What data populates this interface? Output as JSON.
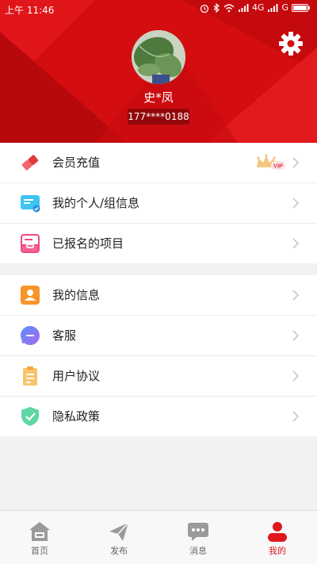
{
  "status": {
    "time": "上午 11:46",
    "network": "4G",
    "network2": "G"
  },
  "profile": {
    "name": "史*凤",
    "phone": "177****0188"
  },
  "menu_group1": [
    {
      "label": "会员充值",
      "icon": "eraser-icon",
      "badge": "VIP"
    },
    {
      "label": "我的个人/组信息",
      "icon": "id-card-icon"
    },
    {
      "label": "已报名的项目",
      "icon": "inbox-icon"
    }
  ],
  "menu_group2": [
    {
      "label": "我的信息",
      "icon": "user-icon"
    },
    {
      "label": "客服",
      "icon": "chat-icon"
    },
    {
      "label": "用户协议",
      "icon": "clipboard-icon"
    },
    {
      "label": "隐私政策",
      "icon": "shield-icon"
    }
  ],
  "tabs": [
    {
      "label": "首页",
      "icon": "home-icon",
      "active": false
    },
    {
      "label": "发布",
      "icon": "paper-plane-icon",
      "active": false
    },
    {
      "label": "消息",
      "icon": "message-icon",
      "active": false
    },
    {
      "label": "我的",
      "icon": "person-icon",
      "active": true
    }
  ],
  "colors": {
    "brand": "#d40d10",
    "tab_active": "#e0181e",
    "tab_inactive": "#9a9a9a"
  }
}
